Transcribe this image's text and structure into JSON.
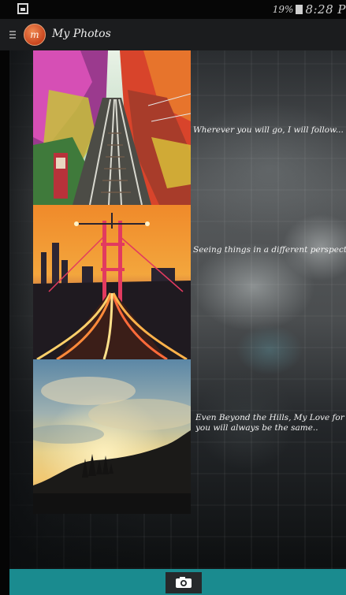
{
  "status_bar": {
    "battery_percent": "19%",
    "time": "8:28 P"
  },
  "action_bar": {
    "title": "My Photos",
    "logo_text": "m"
  },
  "feed": {
    "items": [
      {
        "caption": "Wherever you will go, I will follow...",
        "image": "autumn-railway-track"
      },
      {
        "caption": "Seeing things in a different perspective",
        "image": "bridge-light-trails-at-dusk"
      },
      {
        "caption": "Even Beyond the Hills, My Love for you will always be the same..",
        "image": "sunset-sky-over-hills"
      }
    ]
  },
  "bottom_bar": {
    "camera_icon": "camera-icon",
    "color": "#1a8b8f"
  },
  "colors": {
    "accent": "#1a8b8f",
    "action_bar": "#1b1c1e",
    "logo": "#d9572a"
  }
}
